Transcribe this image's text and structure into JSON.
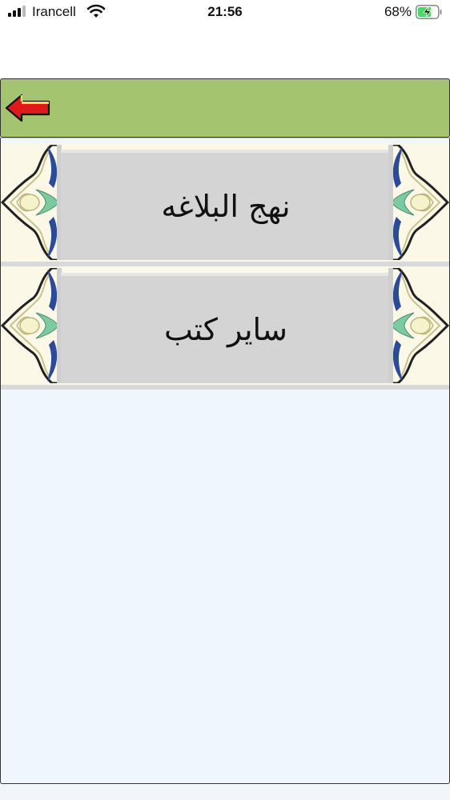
{
  "status_bar": {
    "carrier": "Irancell",
    "time": "21:56",
    "battery_percent": "68%",
    "battery_level": 0.68,
    "charging": true
  },
  "header": {
    "back_icon": "red-left-arrow-icon",
    "header_color": "#a5c46f"
  },
  "menu": {
    "items": [
      {
        "label": "نهج البلاغه"
      },
      {
        "label": "ساير کتب"
      }
    ]
  },
  "colors": {
    "item_background": "#d4d4d4",
    "content_background": "#f0f6fd",
    "ornament_blue": "#2c4a9a",
    "ornament_green": "#7ccaa0"
  }
}
